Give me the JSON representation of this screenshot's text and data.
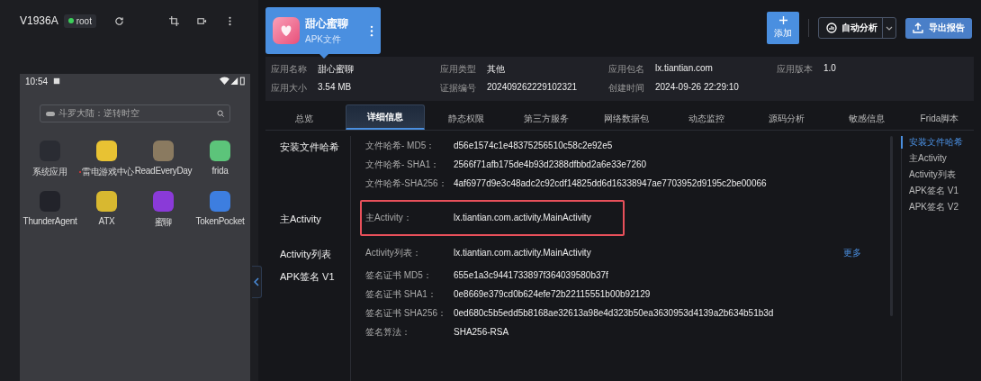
{
  "device": {
    "name": "V1936A",
    "badge": "root",
    "online": true
  },
  "phone": {
    "time": "10:54",
    "search_placeholder": "斗罗大陆：逆转时空",
    "apps": [
      {
        "label": "系统应用",
        "color": "#2a2c33",
        "dot": false
      },
      {
        "label": "雷电游戏中心",
        "color": "#e8c233",
        "dot": true
      },
      {
        "label": "ReadEveryDay",
        "color": "#8a7a60",
        "dot": false
      },
      {
        "label": "frida",
        "color": "#5cc47a",
        "dot": false
      },
      {
        "label": "ThunderAgent",
        "color": "#22232a",
        "dot": false
      },
      {
        "label": "ATX",
        "color": "#d8b830",
        "dot": false
      },
      {
        "label": "蜜聊",
        "color": "#8a3ad8",
        "dot": false
      },
      {
        "label": "TokenPocket",
        "color": "#3d7ee0",
        "dot": false
      }
    ]
  },
  "app_card": {
    "name": "甜心蜜聊",
    "type": "APK文件"
  },
  "actions": {
    "add": "添加",
    "analyze": "自动分析",
    "export": "导出报告"
  },
  "info": [
    {
      "label": "应用名称",
      "value": "甜心蜜聊"
    },
    {
      "label": "应用类型",
      "value": "其他"
    },
    {
      "label": "应用包名",
      "value": "lx.tiantian.com"
    },
    {
      "label": "应用版本",
      "value": "1.0"
    },
    {
      "label": "应用大小",
      "value": "3.54 MB"
    },
    {
      "label": "证据编号",
      "value": "202409262229102321"
    },
    {
      "label": "创建时间",
      "value": "2024-09-26 22:29:10"
    }
  ],
  "tabs": [
    {
      "label": "总览",
      "selected": false
    },
    {
      "label": "详细信息",
      "selected": true
    },
    {
      "label": "静态权限",
      "selected": false
    },
    {
      "label": "第三方服务",
      "selected": false
    },
    {
      "label": "网络数据包",
      "selected": false
    },
    {
      "label": "动态监控",
      "selected": false
    },
    {
      "label": "源码分析",
      "selected": false
    },
    {
      "label": "敏感信息",
      "selected": false
    },
    {
      "label": "Frida脚本",
      "selected": false
    }
  ],
  "sections": [
    {
      "title": "安装文件哈希",
      "rows": [
        {
          "label": "文件哈希- MD5：",
          "value": "d56e1574c1e48375256510c58c2e92e5",
          "highlighted": false
        },
        {
          "label": "文件哈希- SHA1：",
          "value": "2566f71afb175de4b93d2388dfbbd2a6e33e7260",
          "highlighted": false
        },
        {
          "label": "文件哈希-SHA256：",
          "value": "4af6977d9e3c48adc2c92cdf14825dd6d16338947ae7703952d9195c2be00066",
          "highlighted": false
        }
      ]
    },
    {
      "title": "主Activity",
      "rows": [
        {
          "label": "主Activity：",
          "value": "lx.tiantian.com.activity.MainActivity",
          "highlighted": true
        }
      ]
    },
    {
      "title": "Activity列表",
      "more": "更多",
      "rows": [
        {
          "label": "Activity列表：",
          "value": "lx.tiantian.com.activity.MainActivity",
          "highlighted": false
        }
      ]
    },
    {
      "title": "APK签名 V1",
      "rows": [
        {
          "label": "签名证书 MD5：",
          "value": "655e1a3c9441733897f364039580b37f",
          "highlighted": false
        },
        {
          "label": "签名证书 SHA1：",
          "value": "0e8669e379cd0b624efe72b22115551b00b92129",
          "highlighted": false
        },
        {
          "label": "签名证书 SHA256：",
          "value": "0ed680c5b5edd5b8168ae32613a98e4d323b50ea3630953d4139a2b634b51b3d",
          "highlighted": false
        },
        {
          "label": "签名算法：",
          "value": "SHA256-RSA",
          "highlighted": false
        }
      ]
    }
  ],
  "anchors": [
    {
      "label": "安装文件哈希",
      "selected": true
    },
    {
      "label": "主Activity",
      "selected": false
    },
    {
      "label": "Activity列表",
      "selected": false
    },
    {
      "label": "APK签名 V1",
      "selected": false
    },
    {
      "label": "APK签名 V2",
      "selected": false
    }
  ]
}
